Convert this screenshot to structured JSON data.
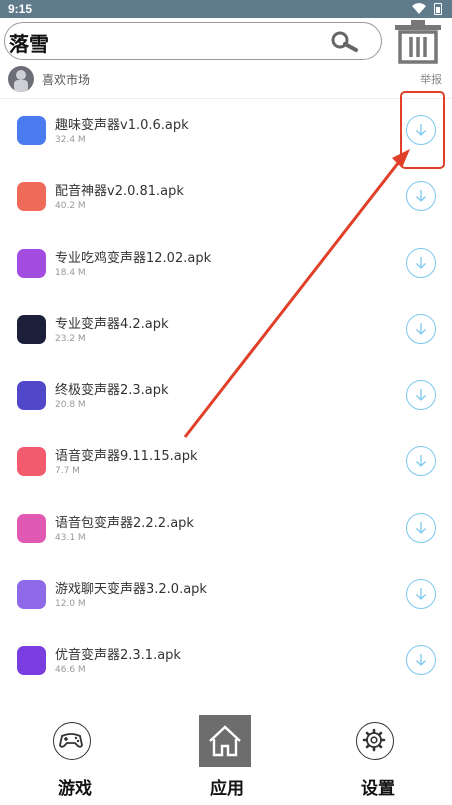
{
  "status": {
    "time": "9:15"
  },
  "search": {
    "query": "落雪"
  },
  "market": {
    "name": "喜欢市场",
    "report_label": "举报"
  },
  "apps": [
    {
      "title": "趣味变声器v1.0.6.apk",
      "size": "32.4 M",
      "icon_color": "#4a7cf0"
    },
    {
      "title": "配音神器v2.0.81.apk",
      "size": "40.2 M",
      "icon_color": "#f06a5a"
    },
    {
      "title": "专业吃鸡变声器12.02.apk",
      "size": "18.4 M",
      "icon_color": "#a34de0"
    },
    {
      "title": "专业变声器4.2.apk",
      "size": "23.2 M",
      "icon_color": "#1c1f3a"
    },
    {
      "title": "终极变声器2.3.apk",
      "size": "20.8 M",
      "icon_color": "#5048c8"
    },
    {
      "title": "语音变声器9.11.15.apk",
      "size": "7.7 M",
      "icon_color": "#f25a6e"
    },
    {
      "title": "语音包变声器2.2.2.apk",
      "size": "43.1 M",
      "icon_color": "#e05ab4"
    },
    {
      "title": "游戏聊天变声器3.2.0.apk",
      "size": "12.0 M",
      "icon_color": "#8f6ae8"
    },
    {
      "title": "优音变声器2.3.1.apk",
      "size": "46.6 M",
      "icon_color": "#7a3ee0"
    }
  ],
  "nav": {
    "games": "游戏",
    "apps": "应用",
    "settings": "设置"
  },
  "colors": {
    "accent": "#7cc8ee",
    "annotation": "#e0402a",
    "statusbar": "#5f7a8a"
  }
}
